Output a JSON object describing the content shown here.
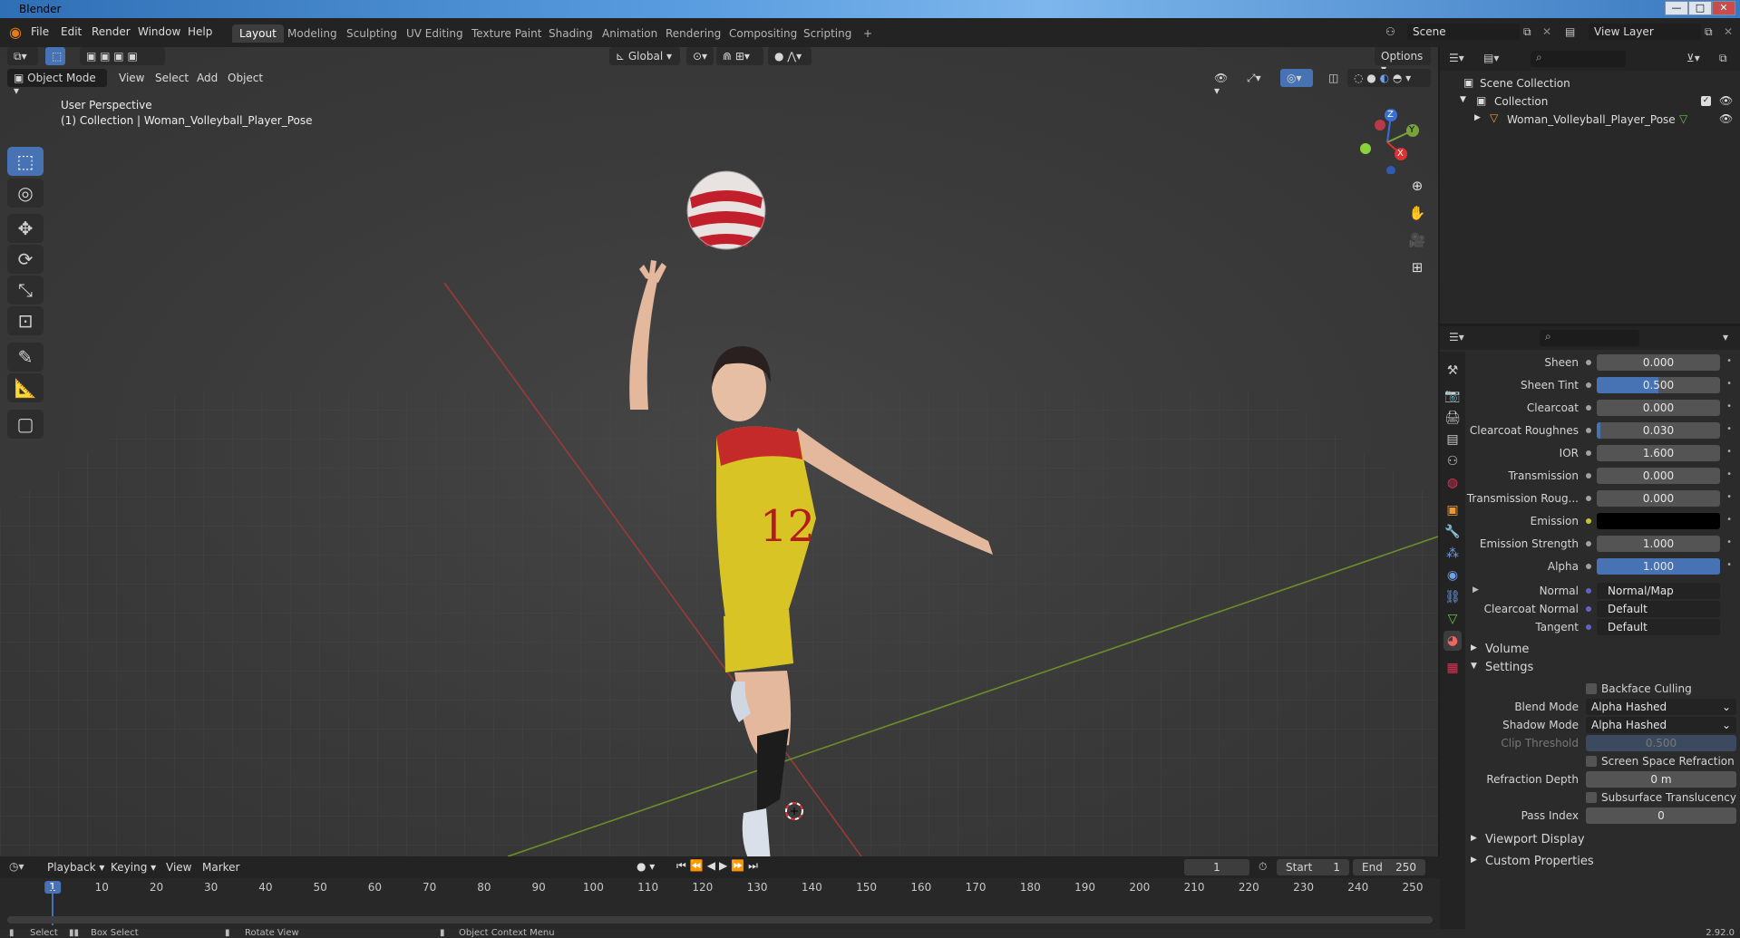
{
  "window": {
    "title": "Blender",
    "min": "—",
    "max": "□",
    "close": "✕"
  },
  "menu": [
    "File",
    "Edit",
    "Render",
    "Window",
    "Help"
  ],
  "workspaces": [
    "Layout",
    "Modeling",
    "Sculpting",
    "UV Editing",
    "Texture Paint",
    "Shading",
    "Animation",
    "Rendering",
    "Compositing",
    "Scripting",
    "+"
  ],
  "scene": {
    "name": "Scene",
    "view_layer": "View Layer"
  },
  "viewport": {
    "transform": "Global",
    "options": "Options",
    "mode": "Object Mode",
    "menus": [
      "View",
      "Select",
      "Add",
      "Object"
    ],
    "perspective": "User Perspective",
    "collection_info": "(1) Collection | Woman_Volleyball_Player_Pose",
    "gizmo": {
      "x": "X",
      "y": "Y",
      "z": "Z"
    }
  },
  "outliner": {
    "scene_collection": "Scene Collection",
    "collection": "Collection",
    "object": "Woman_Volleyball_Player_Pose"
  },
  "properties": {
    "rows": [
      {
        "label": "Sheen",
        "value": "0.000",
        "fill": 0
      },
      {
        "label": "Sheen Tint",
        "value": "0.500",
        "fill": 0.5
      },
      {
        "label": "Clearcoat",
        "value": "0.000",
        "fill": 0
      },
      {
        "label": "Clearcoat Roughnes",
        "value": "0.030",
        "fill": 0.03
      },
      {
        "label": "IOR",
        "value": "1.600",
        "fill": 0
      },
      {
        "label": "Transmission",
        "value": "0.000",
        "fill": 0
      },
      {
        "label": "Transmission Roug...",
        "value": "0.000",
        "fill": 0
      },
      {
        "label": "Emission",
        "value": "",
        "fill": 0
      },
      {
        "label": "Emission Strength",
        "value": "1.000",
        "fill": 0
      },
      {
        "label": "Alpha",
        "value": "1.000",
        "fill": 1
      }
    ],
    "links": [
      {
        "label": "Normal",
        "value": "Normal/Map"
      },
      {
        "label": "Clearcoat Normal",
        "value": "Default"
      },
      {
        "label": "Tangent",
        "value": "Default"
      }
    ],
    "sections": {
      "volume": "Volume",
      "settings": "Settings",
      "viewport_display": "Viewport Display",
      "custom_properties": "Custom Properties"
    },
    "settings": {
      "backface": "Backface Culling",
      "blend_label": "Blend Mode",
      "blend_value": "Alpha Hashed",
      "shadow_label": "Shadow Mode",
      "shadow_value": "Alpha Hashed",
      "clip_label": "Clip Threshold",
      "clip_value": "0.500",
      "ssr": "Screen Space Refraction",
      "refr_label": "Refraction Depth",
      "refr_value": "0 m",
      "sss": "Subsurface Translucency",
      "pass_label": "Pass Index",
      "pass_value": "0"
    }
  },
  "timeline": {
    "menus": [
      "Playback",
      "Keying",
      "View",
      "Marker"
    ],
    "current_frame": "1",
    "start_label": "Start",
    "start": "1",
    "end_label": "End",
    "end": "250",
    "ticks": [
      "1",
      "10",
      "20",
      "30",
      "40",
      "50",
      "60",
      "70",
      "80",
      "90",
      "100",
      "110",
      "120",
      "130",
      "140",
      "150",
      "160",
      "170",
      "180",
      "190",
      "200",
      "210",
      "220",
      "230",
      "240",
      "250"
    ]
  },
  "status": {
    "select": "Select",
    "box_select": "Box Select",
    "rotate": "Rotate View",
    "context": "Object Context Menu",
    "version": "2.92.0"
  }
}
